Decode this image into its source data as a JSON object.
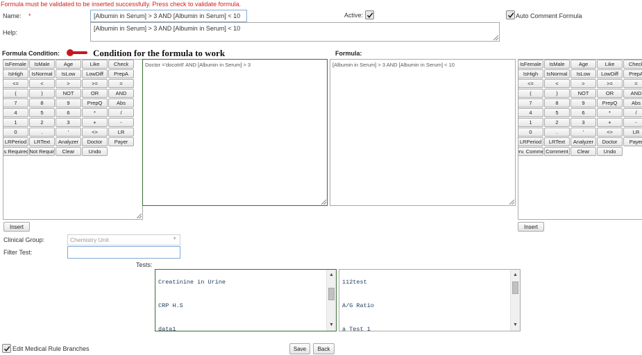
{
  "warning": "Formula must be validated to be inserted successfully. Press check to validate formula.",
  "name": {
    "label": "Name:",
    "required_mark": "*",
    "value": "[Albumin in Serum] > 3 AND [Albumin in Serum] < 10"
  },
  "active": {
    "label": "Active:",
    "checked": true
  },
  "auto_comment": {
    "label": "Auto Comment Formula",
    "checked": true
  },
  "help": {
    "label": "Help:",
    "value": "[Albumin in Serum] > 3 AND [Albumin in Serum] < 10"
  },
  "formula_condition": {
    "label": "Formula Condition:",
    "annotation": "Condition for the formula to work"
  },
  "formula": {
    "label": "Formula:"
  },
  "keypad_left": [
    [
      "IsFemale",
      "IsMale",
      "Age",
      "Like",
      "Check"
    ],
    [
      "IsHigh",
      "IsNormal",
      "IsLow",
      "LowDiff",
      "PrepA"
    ],
    [
      "<=",
      "<",
      ">",
      ">=",
      "="
    ],
    [
      "(",
      ")",
      "NOT",
      "OR",
      "AND"
    ],
    [
      "7",
      "8",
      "9",
      "PrepQ",
      "Abs"
    ],
    [
      "4",
      "5",
      "6",
      "*",
      "/"
    ],
    [
      "1",
      "2",
      "3",
      "+",
      "-"
    ],
    [
      "0",
      ".",
      "'",
      "<>",
      "LR"
    ],
    [
      "LRPeriod",
      "LRText",
      "Analyzer",
      "Doctor",
      "Payer"
    ],
    [
      "Is Required",
      "Is Not Required",
      "Clear",
      "Undo"
    ]
  ],
  "keypad_right": [
    [
      "IsFemale",
      "IsMale",
      "Age",
      "Like",
      "Check"
    ],
    [
      "IsHigh",
      "IsNormal",
      "IsLow",
      "LowDiff",
      "PrepA"
    ],
    [
      "<=",
      "<",
      ">",
      ">=",
      "="
    ],
    [
      "(",
      ")",
      "NOT",
      "OR",
      "AND"
    ],
    [
      "7",
      "8",
      "9",
      "PrepQ",
      "Abs"
    ],
    [
      "4",
      "5",
      "6",
      "*",
      "/"
    ],
    [
      "1",
      "2",
      "3",
      "+",
      "-"
    ],
    [
      "0",
      ".",
      "'",
      "<>",
      "LR"
    ],
    [
      "LRPeriod",
      "LRText",
      "Analyzer",
      "Doctor",
      "Payer"
    ],
    [
      "Serv. Comment",
      "Comment",
      "Clear",
      "Undo"
    ]
  ],
  "condition_text": "Doctor ='docotr8' AND [Albumin in Serum] > 3",
  "formula_text": "[Albumin in Serum] > 3 AND [Albumin in Serum] < 10",
  "insert_label": "Insert",
  "clinical_group": {
    "label": "Clinical Group:",
    "value": "Chemistry Unit"
  },
  "filter_test": {
    "label": "Filter Test:",
    "value": ""
  },
  "tests": {
    "label": "Tests:",
    "left_items": [
      "Creatinine in Urine",
      "CRP H.S",
      "data1"
    ],
    "right_items": [
      "112test",
      "A/G Ratio",
      "a Test 1"
    ]
  },
  "edit_branches": {
    "label": "Edit Medical Rule Branches",
    "checked": true
  },
  "save_label": "Save",
  "back_label": "Back",
  "colors": {
    "warning": "#d42020",
    "green_border": "#3a6b35",
    "annotation_pin": "#c8161d"
  }
}
